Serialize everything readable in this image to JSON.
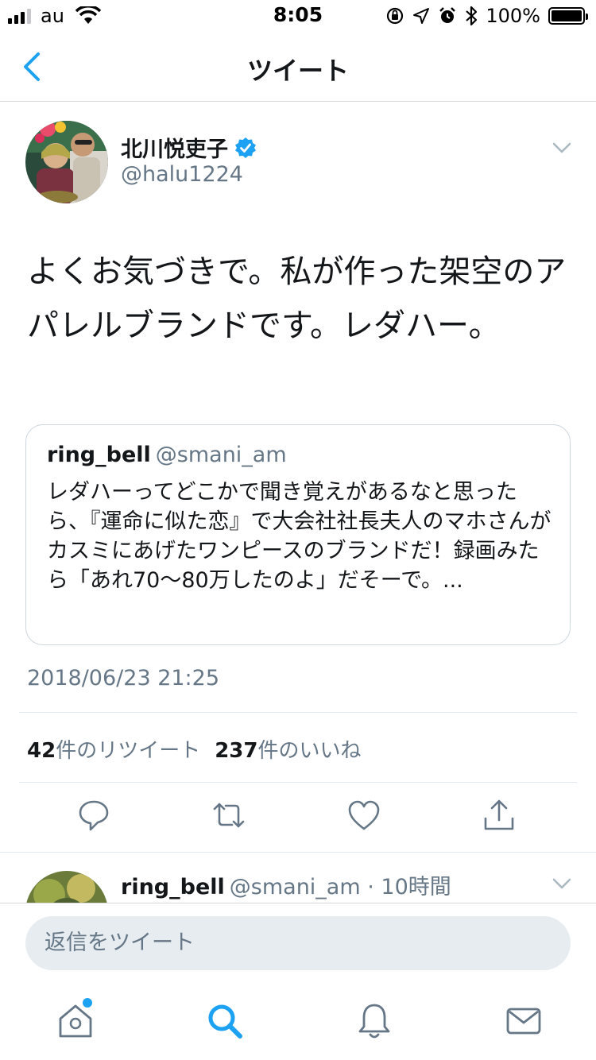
{
  "status_bar": {
    "carrier": "au",
    "time": "8:05",
    "battery": "100%"
  },
  "nav": {
    "title": "ツイート",
    "back_icon": "chevron-left-icon"
  },
  "tweet": {
    "author_name": "北川悦吏子",
    "author_handle": "@halu1224",
    "verified": true,
    "text": "よくお気づきで。私が作った架空のアパレルブランドです。レダハー。",
    "quote": {
      "name": "ring_bell",
      "handle": "@smani_am",
      "text": "レダハーってどこかで聞き覚えがあるなと思ったら、『運命に似た恋』で大会社社長夫人のマホさんがカスミにあげたワンピースのブランドだ！録画みたら「あれ70〜80万したのよ」だそーで。..."
    },
    "timestamp": "2018/06/23 21:25",
    "retweet_count": "42",
    "retweet_label": "件のリツイート",
    "like_count": "237",
    "like_label": "件のいいね"
  },
  "actions": [
    "reply-icon",
    "retweet-icon",
    "like-icon",
    "share-icon"
  ],
  "reply": {
    "name": "ring_bell",
    "meta": "@smani_am · 10時間"
  },
  "composer": {
    "placeholder": "返信をツイート"
  },
  "tabs": [
    "home-icon",
    "search-icon",
    "notifications-icon",
    "messages-icon"
  ],
  "colors": {
    "accent": "#1da1f2",
    "secondary_text": "#657786",
    "divider": "#e1e8ed"
  }
}
